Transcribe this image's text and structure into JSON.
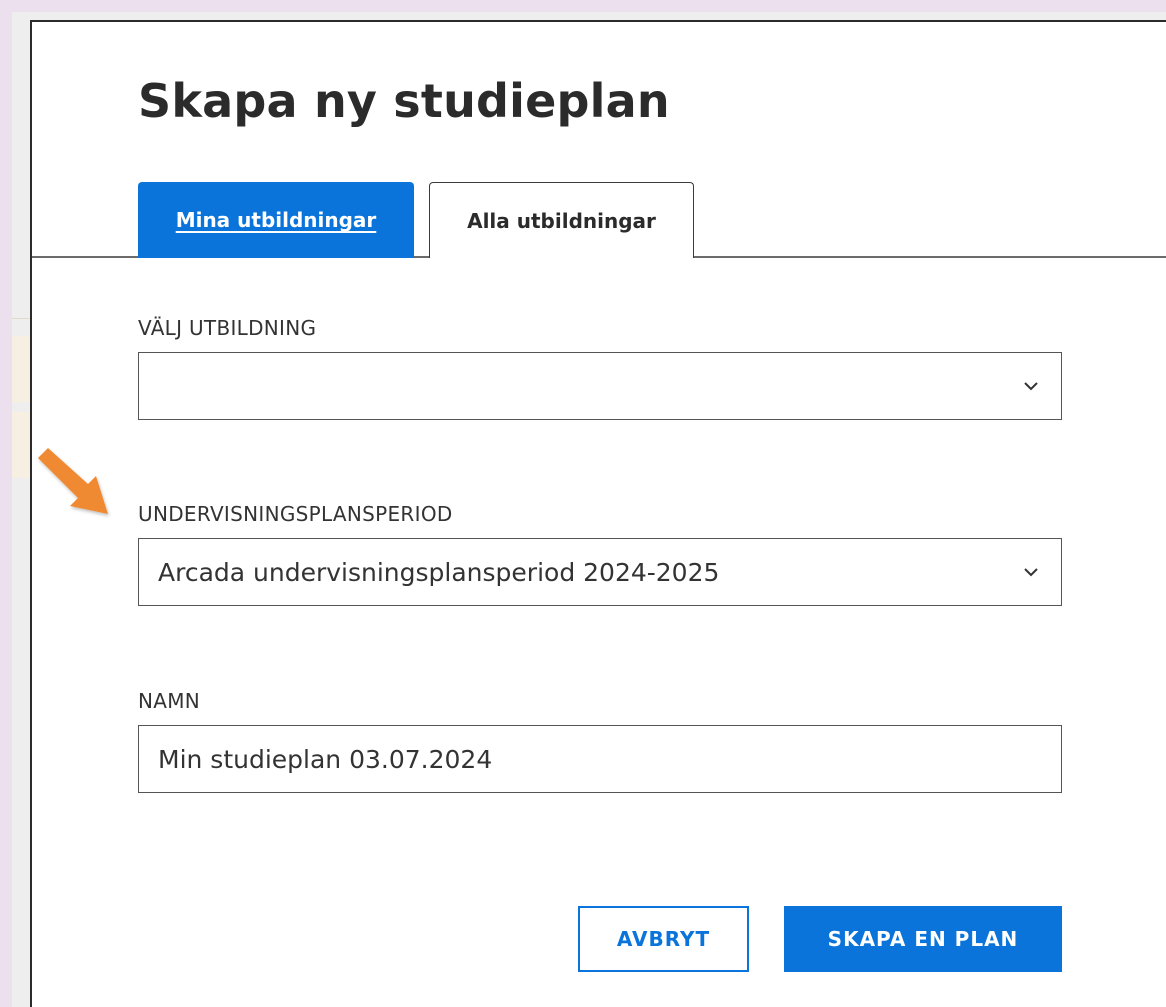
{
  "dialog": {
    "title": "Skapa ny studieplan",
    "tabs": [
      {
        "label": "Mina utbildningar",
        "active": true
      },
      {
        "label": "Alla utbildningar",
        "active": false
      }
    ],
    "fields": {
      "education": {
        "label": "VÄLJ UTBILDNING",
        "value": ""
      },
      "curriculum_period": {
        "label": "UNDERVISNINGSPLANSPERIOD",
        "value": "Arcada undervisningsplansperiod 2024-2025"
      },
      "name": {
        "label": "NAMN",
        "value": "Min studieplan 03.07.2024"
      }
    },
    "buttons": {
      "cancel_label": "AVBRYT",
      "create_label": "SKAPA EN PLAN"
    }
  },
  "icons": {
    "dropdown": "chevron-down-icon",
    "annotation": "arrow-pointer-icon"
  },
  "colors": {
    "primary": "#0a74da",
    "annotation_arrow": "#f08a30",
    "backdrop": "#ece0ee"
  }
}
